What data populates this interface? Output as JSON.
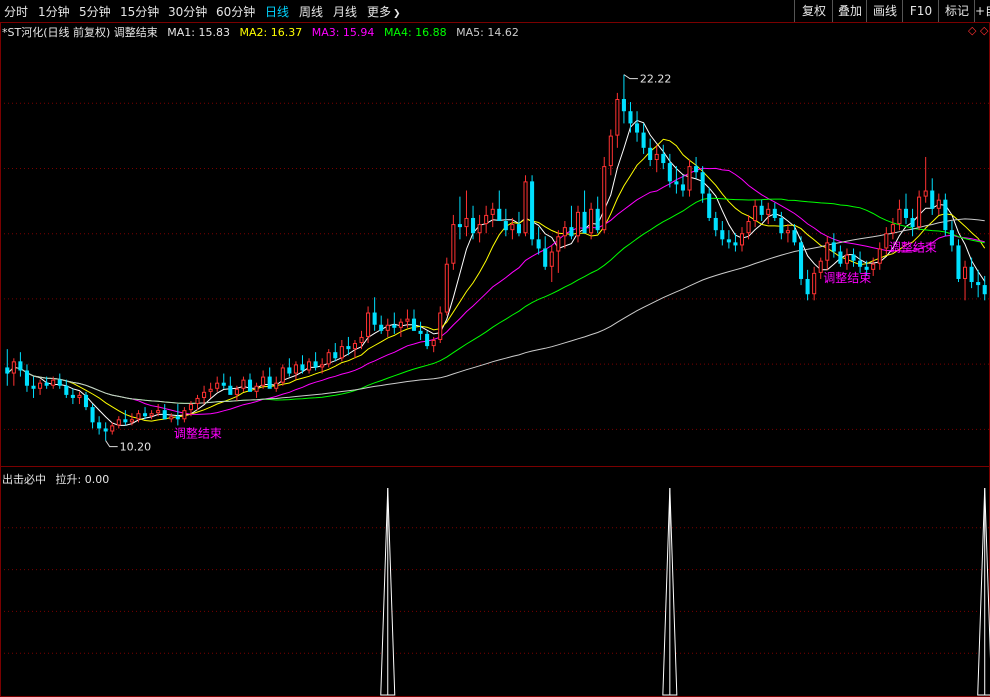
{
  "toolbar": {
    "periods": [
      "分时",
      "1分钟",
      "5分钟",
      "15分钟",
      "30分钟",
      "60分钟",
      "日线",
      "周线",
      "月线",
      "更多"
    ],
    "more_arrow": "❯",
    "active": "日线",
    "right_buttons": [
      "复权",
      "叠加",
      "画线",
      "F10",
      "标记",
      "+自"
    ]
  },
  "header": {
    "title": "*ST河化(日线 前复权) 调整结束",
    "ma": [
      {
        "label": "MA1: 15.83",
        "color": "#ffffff"
      },
      {
        "label": "MA2: 16.37",
        "color": "#ffff00"
      },
      {
        "label": "MA3: 15.94",
        "color": "#ff00ff"
      },
      {
        "label": "MA4: 16.88",
        "color": "#00ff00"
      },
      {
        "label": "MA5: 14.62",
        "color": "#cccccc"
      }
    ],
    "right_mark": "◇ ◇"
  },
  "indicator": {
    "name": "出击必中",
    "value_label": "拉升: 0.00"
  },
  "colors": {
    "up": "#ff3232",
    "down": "#00e0ff",
    "ma1": "#ffffff",
    "ma2": "#ffff00",
    "ma3": "#ff00ff",
    "ma4": "#00ff00",
    "ma5": "#cccccc",
    "signal": "#ff00ff",
    "grid": "#7a0000"
  },
  "chart_data": {
    "type": "candlestick",
    "price_range": [
      9.5,
      23.4
    ],
    "high_annotation": {
      "label": "22.22",
      "value": 22.22
    },
    "low_annotation": {
      "label": "10.20",
      "value": 10.2
    },
    "signal_label": "调整结束",
    "signal_bars": [
      26,
      125,
      135
    ],
    "indicator_spikes": [
      58,
      101,
      149
    ],
    "candles": [
      [
        12.6,
        13.2,
        12.0,
        12.4
      ],
      [
        12.4,
        12.9,
        12.0,
        12.8
      ],
      [
        12.8,
        13.1,
        12.3,
        12.5
      ],
      [
        12.5,
        12.7,
        11.8,
        12.0
      ],
      [
        12.0,
        12.3,
        11.6,
        11.9
      ],
      [
        11.9,
        12.2,
        11.7,
        12.1
      ],
      [
        12.1,
        12.3,
        11.9,
        12.0
      ],
      [
        12.0,
        12.3,
        11.9,
        12.2
      ],
      [
        12.2,
        12.4,
        11.9,
        12.0
      ],
      [
        12.0,
        12.2,
        11.6,
        11.7
      ],
      [
        11.7,
        11.9,
        11.4,
        11.6
      ],
      [
        11.6,
        11.8,
        11.4,
        11.7
      ],
      [
        11.7,
        11.8,
        11.2,
        11.3
      ],
      [
        11.3,
        11.4,
        10.6,
        10.8
      ],
      [
        10.8,
        11.0,
        10.4,
        10.6
      ],
      [
        10.6,
        10.8,
        10.2,
        10.5
      ],
      [
        10.5,
        10.8,
        10.4,
        10.7
      ],
      [
        10.7,
        11.0,
        10.6,
        10.9
      ],
      [
        10.9,
        11.2,
        10.7,
        10.8
      ],
      [
        10.8,
        11.1,
        10.7,
        10.9
      ],
      [
        10.9,
        11.2,
        10.8,
        11.1
      ],
      [
        11.1,
        11.3,
        10.9,
        11.0
      ],
      [
        11.0,
        11.2,
        10.9,
        11.1
      ],
      [
        11.1,
        11.4,
        11.0,
        11.2
      ],
      [
        11.2,
        11.4,
        11.0,
        10.9
      ],
      [
        10.9,
        11.1,
        10.8,
        11.0
      ],
      [
        11.0,
        11.4,
        10.7,
        10.9
      ],
      [
        10.9,
        11.3,
        10.8,
        11.2
      ],
      [
        11.2,
        11.5,
        11.0,
        11.4
      ],
      [
        11.4,
        11.7,
        11.2,
        11.6
      ],
      [
        11.6,
        12.0,
        11.4,
        11.8
      ],
      [
        11.8,
        12.1,
        11.6,
        11.9
      ],
      [
        11.9,
        12.3,
        11.8,
        12.1
      ],
      [
        12.1,
        12.4,
        11.9,
        12.0
      ],
      [
        12.0,
        12.3,
        11.8,
        11.7
      ],
      [
        11.7,
        12.0,
        11.5,
        11.9
      ],
      [
        11.9,
        12.3,
        11.8,
        12.2
      ],
      [
        12.2,
        12.4,
        11.9,
        11.8
      ],
      [
        11.8,
        12.1,
        11.6,
        12.0
      ],
      [
        12.0,
        12.5,
        11.9,
        12.3
      ],
      [
        12.3,
        12.6,
        12.0,
        11.9
      ],
      [
        11.9,
        12.3,
        11.8,
        12.1
      ],
      [
        12.1,
        12.7,
        12.0,
        12.6
      ],
      [
        12.6,
        12.9,
        12.3,
        12.4
      ],
      [
        12.4,
        12.8,
        12.2,
        12.7
      ],
      [
        12.7,
        13.0,
        12.4,
        12.5
      ],
      [
        12.5,
        12.9,
        12.4,
        12.8
      ],
      [
        12.8,
        13.1,
        12.5,
        12.6
      ],
      [
        12.6,
        12.9,
        12.4,
        12.7
      ],
      [
        12.7,
        13.2,
        12.6,
        13.1
      ],
      [
        13.1,
        13.4,
        12.8,
        12.9
      ],
      [
        12.9,
        13.5,
        12.8,
        13.3
      ],
      [
        13.3,
        13.6,
        13.0,
        13.2
      ],
      [
        13.2,
        13.5,
        12.9,
        13.4
      ],
      [
        13.4,
        13.8,
        13.2,
        13.6
      ],
      [
        13.6,
        14.6,
        13.4,
        14.4
      ],
      [
        14.4,
        14.9,
        13.8,
        14.0
      ],
      [
        14.0,
        14.3,
        13.7,
        13.8
      ],
      [
        13.8,
        14.2,
        13.6,
        14.0
      ],
      [
        14.0,
        14.4,
        13.7,
        13.9
      ],
      [
        13.9,
        14.2,
        13.6,
        14.1
      ],
      [
        14.1,
        14.5,
        13.9,
        14.2
      ],
      [
        14.2,
        14.5,
        13.8,
        13.8
      ],
      [
        13.8,
        14.1,
        13.5,
        13.7
      ],
      [
        13.7,
        13.8,
        13.2,
        13.3
      ],
      [
        13.3,
        13.6,
        13.1,
        13.5
      ],
      [
        13.5,
        14.6,
        13.4,
        14.4
      ],
      [
        14.4,
        16.2,
        14.3,
        16.0
      ],
      [
        16.0,
        17.6,
        15.8,
        17.3
      ],
      [
        17.3,
        18.2,
        16.8,
        17.2
      ],
      [
        17.2,
        18.4,
        16.9,
        17.5
      ],
      [
        17.5,
        17.9,
        16.8,
        17.0
      ],
      [
        17.0,
        17.6,
        16.7,
        17.3
      ],
      [
        17.3,
        17.9,
        17.0,
        17.6
      ],
      [
        17.6,
        18.0,
        17.2,
        17.8
      ],
      [
        17.8,
        18.4,
        17.4,
        17.4
      ],
      [
        17.4,
        17.8,
        16.9,
        17.1
      ],
      [
        17.1,
        17.5,
        16.8,
        17.3
      ],
      [
        17.3,
        17.7,
        16.9,
        17.0
      ],
      [
        17.0,
        18.9,
        16.9,
        18.7
      ],
      [
        18.7,
        18.9,
        16.6,
        16.8
      ],
      [
        16.8,
        17.2,
        16.3,
        16.5
      ],
      [
        16.5,
        16.9,
        15.8,
        15.9
      ],
      [
        15.9,
        16.6,
        15.4,
        16.4
      ],
      [
        16.4,
        17.1,
        15.7,
        16.9
      ],
      [
        16.9,
        17.4,
        16.5,
        17.2
      ],
      [
        17.2,
        17.9,
        16.8,
        16.9
      ],
      [
        16.9,
        17.9,
        16.7,
        17.7
      ],
      [
        17.7,
        18.4,
        17.2,
        17.0
      ],
      [
        17.0,
        18.0,
        16.8,
        17.8
      ],
      [
        17.8,
        18.2,
        17.0,
        17.1
      ],
      [
        17.1,
        19.5,
        17.0,
        19.2
      ],
      [
        19.2,
        20.4,
        18.9,
        20.2
      ],
      [
        20.2,
        21.6,
        19.8,
        21.4
      ],
      [
        21.4,
        22.2,
        20.6,
        21.0
      ],
      [
        21.0,
        21.3,
        20.3,
        20.6
      ],
      [
        20.6,
        21.0,
        20.0,
        20.3
      ],
      [
        20.3,
        20.6,
        19.6,
        19.8
      ],
      [
        19.8,
        20.1,
        19.2,
        19.4
      ],
      [
        19.4,
        19.9,
        19.0,
        19.6
      ],
      [
        19.6,
        19.9,
        19.1,
        19.3
      ],
      [
        19.3,
        19.6,
        18.5,
        18.7
      ],
      [
        18.7,
        19.2,
        18.3,
        18.6
      ],
      [
        18.6,
        18.9,
        18.2,
        18.4
      ],
      [
        18.4,
        19.4,
        18.2,
        19.2
      ],
      [
        19.2,
        19.5,
        18.8,
        19.0
      ],
      [
        19.0,
        19.2,
        18.0,
        18.3
      ],
      [
        18.3,
        18.5,
        17.4,
        17.5
      ],
      [
        17.5,
        17.7,
        16.9,
        17.1
      ],
      [
        17.1,
        17.4,
        16.6,
        16.8
      ],
      [
        16.8,
        17.1,
        16.5,
        16.7
      ],
      [
        16.7,
        17.0,
        16.4,
        16.6
      ],
      [
        16.6,
        17.2,
        16.4,
        17.0
      ],
      [
        17.0,
        17.6,
        16.8,
        17.4
      ],
      [
        17.4,
        18.1,
        17.2,
        17.9
      ],
      [
        17.9,
        18.1,
        17.4,
        17.6
      ],
      [
        17.6,
        18.0,
        17.3,
        17.8
      ],
      [
        17.8,
        18.0,
        17.4,
        17.5
      ],
      [
        17.5,
        17.7,
        16.8,
        17.0
      ],
      [
        17.0,
        17.3,
        16.7,
        17.1
      ],
      [
        17.1,
        17.3,
        16.6,
        16.7
      ],
      [
        16.7,
        16.9,
        15.3,
        15.5
      ],
      [
        15.5,
        15.8,
        14.8,
        15.0
      ],
      [
        15.0,
        15.9,
        14.8,
        15.7
      ],
      [
        15.7,
        16.2,
        15.5,
        16.1
      ],
      [
        16.1,
        16.9,
        15.8,
        16.7
      ],
      [
        16.7,
        17.0,
        16.2,
        16.4
      ],
      [
        16.4,
        16.6,
        15.9,
        16.0
      ],
      [
        16.0,
        16.5,
        15.8,
        16.3
      ],
      [
        16.3,
        16.5,
        15.9,
        16.1
      ],
      [
        16.1,
        16.4,
        15.7,
        15.9
      ],
      [
        15.9,
        16.1,
        15.6,
        15.8
      ],
      [
        15.8,
        16.2,
        15.6,
        16.0
      ],
      [
        16.0,
        16.7,
        15.8,
        16.5
      ],
      [
        16.5,
        17.2,
        16.3,
        17.0
      ],
      [
        17.0,
        17.5,
        16.8,
        17.3
      ],
      [
        17.3,
        18.1,
        17.1,
        17.8
      ],
      [
        17.8,
        18.3,
        17.3,
        17.5
      ],
      [
        17.5,
        17.8,
        16.9,
        17.2
      ],
      [
        17.2,
        18.4,
        17.1,
        18.2
      ],
      [
        18.2,
        19.5,
        18.0,
        18.4
      ],
      [
        18.4,
        18.8,
        17.6,
        17.8
      ],
      [
        17.8,
        18.3,
        17.6,
        18.1
      ],
      [
        18.1,
        18.3,
        16.9,
        17.1
      ],
      [
        17.1,
        17.4,
        16.4,
        16.6
      ],
      [
        16.6,
        16.8,
        15.4,
        15.5
      ],
      [
        15.5,
        16.1,
        14.8,
        15.9
      ],
      [
        15.9,
        16.2,
        15.2,
        15.4
      ],
      [
        15.4,
        15.8,
        14.9,
        15.3
      ],
      [
        15.3,
        15.6,
        14.8,
        15.0
      ]
    ]
  }
}
